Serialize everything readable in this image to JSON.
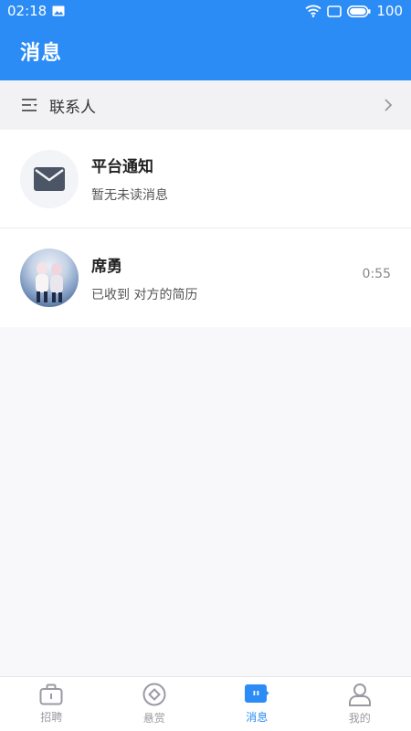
{
  "status_bar": {
    "time": "02:18",
    "battery": "100"
  },
  "header": {
    "title": "消息"
  },
  "contacts": {
    "label": "联系人"
  },
  "messages": [
    {
      "title": "平台通知",
      "subtitle": "暂无未读消息",
      "time": "",
      "avatar": "mail-icon"
    },
    {
      "title": "席勇",
      "subtitle": "已收到 对方的简历",
      "time": "0:55",
      "avatar": "user-photo"
    }
  ],
  "tabs": [
    {
      "label": "招聘",
      "icon": "briefcase-icon",
      "active": false
    },
    {
      "label": "悬赏",
      "icon": "reward-icon",
      "active": false
    },
    {
      "label": "消息",
      "icon": "message-icon",
      "active": true
    },
    {
      "label": "我的",
      "icon": "person-icon",
      "active": false
    }
  ],
  "colors": {
    "primary": "#2b8cf6",
    "background": "#f8f8fb",
    "inactive_tab": "#9a9aa3"
  }
}
